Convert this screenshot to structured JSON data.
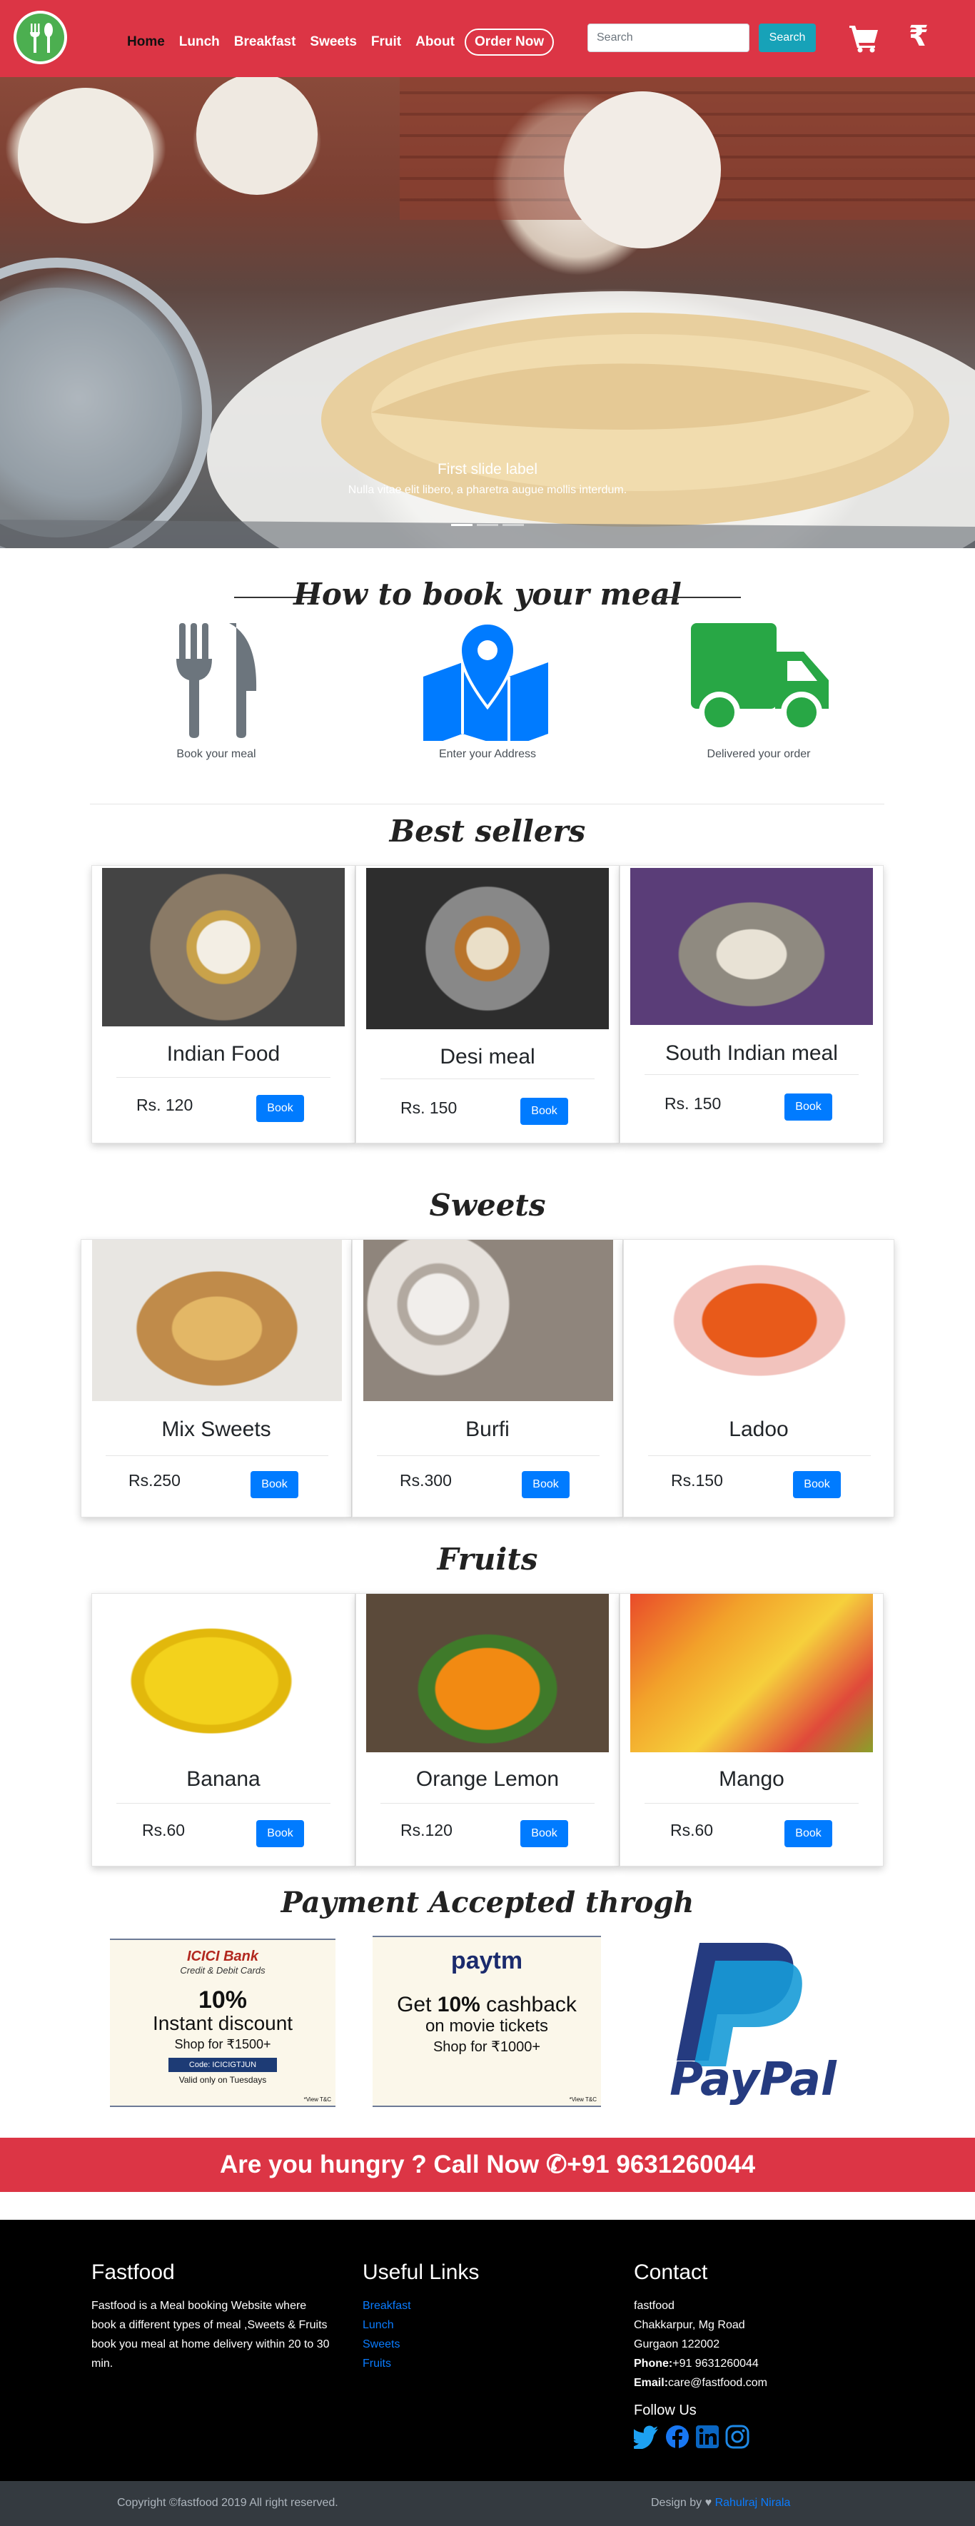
{
  "nav": {
    "links": [
      "Home",
      "Lunch",
      "Breakfast",
      "Sweets",
      "Fruit",
      "About"
    ],
    "order_button": "Order Now",
    "search_placeholder": "Search",
    "search_button": "Search"
  },
  "hero": {
    "caption_title": "First slide label",
    "caption_text": "Nulla vitae elit libero, a pharetra augue mollis interdum.",
    "active_slide": 1,
    "slide_count": 3
  },
  "how_to_book": {
    "title": "How to book your meal",
    "steps": [
      {
        "label": "Book your meal",
        "icon": "fork-knife-icon",
        "color": "#6c757d"
      },
      {
        "label": "Enter your Address",
        "icon": "map-marker-icon",
        "color": "#007bff"
      },
      {
        "label": "Delivered your order",
        "icon": "truck-icon",
        "color": "#28a745"
      }
    ]
  },
  "best_sellers": {
    "title": "Best sellers",
    "items": [
      {
        "name": "Indian Food",
        "price": "Rs. 120",
        "button": "Book"
      },
      {
        "name": "Desi meal",
        "price": "Rs. 150",
        "button": "Book"
      },
      {
        "name": "South Indian meal",
        "price": "Rs. 150",
        "button": "Book"
      }
    ]
  },
  "sweets": {
    "title": "Sweets",
    "items": [
      {
        "name": "Mix Sweets",
        "price": "Rs.250",
        "button": "Book"
      },
      {
        "name": "Burfi",
        "price": "Rs.300",
        "button": "Book"
      },
      {
        "name": "Ladoo",
        "price": "Rs.150",
        "button": "Book"
      }
    ]
  },
  "fruits": {
    "title": "Fruits",
    "items": [
      {
        "name": "Banana",
        "price": "Rs.60",
        "button": "Book"
      },
      {
        "name": "Orange Lemon",
        "price": "Rs.120",
        "button": "Book"
      },
      {
        "name": "Mango",
        "price": "Rs.60",
        "button": "Book"
      }
    ]
  },
  "payment": {
    "title": "Payment Accepted throgh",
    "icici": {
      "brand": "ICICI Bank",
      "sub": "Credit & Debit Cards",
      "big": "10%",
      "mid": "Instant discount",
      "shop": "Shop for ₹1500+",
      "code": "Code: ICICIGTJUN",
      "valid": "Valid only on Tuesdays",
      "tc": "*View T&C"
    },
    "paytm": {
      "brand": "paytm",
      "big1": "Get",
      "big2": "10%",
      "big3": "cashback",
      "mid": "on movie tickets",
      "shop": "Shop for ₹1000+",
      "tc": "*View T&C"
    },
    "paypal": "PayPal"
  },
  "call_banner": {
    "text": "Are you hungry ? Call Now",
    "phone": "+91 9631260044"
  },
  "footer": {
    "about": {
      "title": "Fastfood",
      "text": "Fastfood is a Meal booking Website where book a different types of meal ,Sweets & Fruits book you meal at home delivery within 20 to 30 min."
    },
    "links": {
      "title": "Useful Links",
      "items": [
        "Breakfast",
        "Lunch",
        "Sweets",
        "Fruits"
      ]
    },
    "contact": {
      "title": "Contact",
      "lines": [
        "fastfood",
        "Chakkarpur, Mg Road",
        "Gurgaon 122002"
      ],
      "phone_label": "Phone:",
      "phone": "+91 9631260044",
      "email_label": "Email:",
      "email": "care@fastfood.com",
      "follow": "Follow Us"
    }
  },
  "copyright": {
    "text": "Copyright ©fastfood 2019 All right reserved.",
    "design_prefix": "Design by",
    "author": "Rahulraj Nirala"
  }
}
